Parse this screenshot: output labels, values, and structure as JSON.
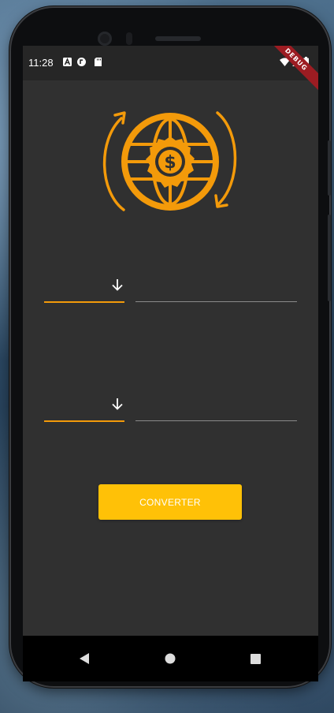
{
  "status_bar": {
    "time": "11:28",
    "icons": [
      "a-icon",
      "app-icon",
      "sd-card-icon"
    ],
    "right_icons": [
      "wifi-icon",
      "signal-icon",
      "battery-icon"
    ],
    "debug_banner": "DEBUG"
  },
  "logo": {
    "icon": "currency-exchange-globe-icon",
    "color": "#f39a0a"
  },
  "converter": {
    "from": {
      "currency": "",
      "amount": "",
      "arrow_icon": "arrow-down-icon"
    },
    "to": {
      "currency": "",
      "amount": "",
      "arrow_icon": "arrow-down-icon"
    },
    "button_label": "CONVERTER"
  },
  "nav": {
    "back_icon": "back-triangle-icon",
    "home_icon": "home-circle-icon",
    "recents_icon": "recents-square-icon"
  },
  "colors": {
    "accent": "#f39a0a",
    "button": "#ffc107",
    "background": "#303030",
    "statusbar": "#262626"
  }
}
